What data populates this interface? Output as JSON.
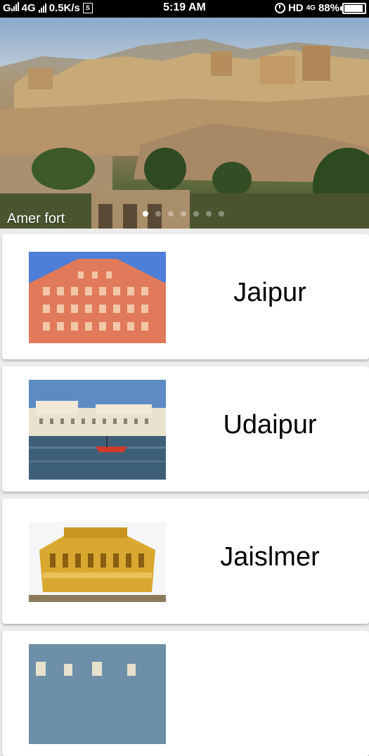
{
  "status_bar": {
    "network_label": "4G",
    "speed": "0.5K/s",
    "time": "5:19 AM",
    "hd_label": "HD",
    "net2_label": "4G",
    "battery": "88%"
  },
  "carousel": {
    "caption": "Amer fort",
    "page_count": 7,
    "active_index": 0
  },
  "cities": [
    {
      "name": "Jaipur"
    },
    {
      "name": "Udaipur"
    },
    {
      "name": "Jaislmer"
    },
    {
      "name": ""
    }
  ]
}
